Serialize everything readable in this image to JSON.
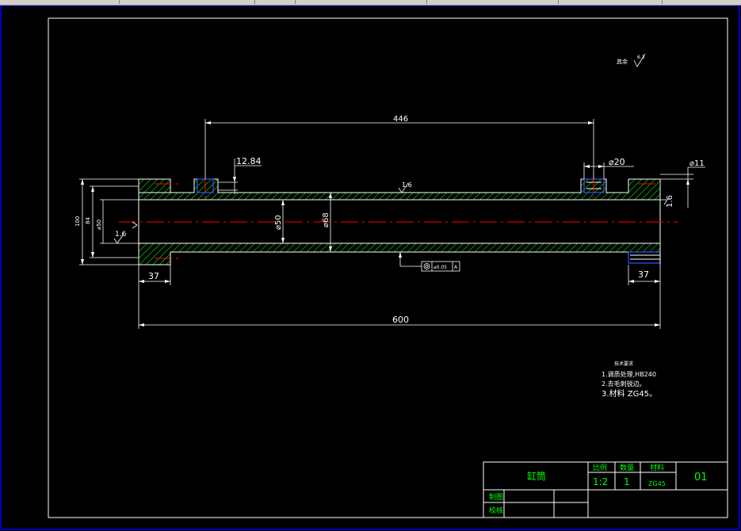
{
  "drawing": {
    "dim_length_446": "446",
    "dim_12_84": "12.84",
    "dim_dia20": "⌀20",
    "dim_dia11": "⌀11",
    "dim_1_6": "1.6",
    "dim_100": "100",
    "dim_84": "84",
    "dim_dia50_tol": "⌀50",
    "dim_1_6_left": "1.6",
    "dim_dia50": "⌀50",
    "dim_dia68": "⌀68",
    "dim_37_left": "37",
    "dim_37_right": "37",
    "dim_600": "600",
    "roughness_top": "1.6",
    "tolerance_value": "⌀0.05",
    "tolerance_datum": "A",
    "roughness_note_label": "其余",
    "roughness_note_value": "6.3"
  },
  "notes": {
    "title": "技术要求",
    "line1": "1.调质处理,HB240",
    "line2": "2.去毛刺锐边。",
    "line3": "3.材料 ZG45。"
  },
  "title_block": {
    "part_name": "缸筒",
    "scale_label": "比例",
    "qty_label": "数量",
    "material_label": "材料",
    "scale_value": "1:2",
    "qty_value": "1",
    "material_value": "ZG45",
    "drawing_no": "01",
    "drawn_label": "制图",
    "checked_label": "校核"
  },
  "colors": {
    "background": "#000000",
    "outline": "#ffffff",
    "centerline": "#ff0000",
    "hatch": "#00cc00",
    "holes": "#3355ff",
    "border": "#0000ff",
    "titleblock_text": "#00ff00"
  }
}
